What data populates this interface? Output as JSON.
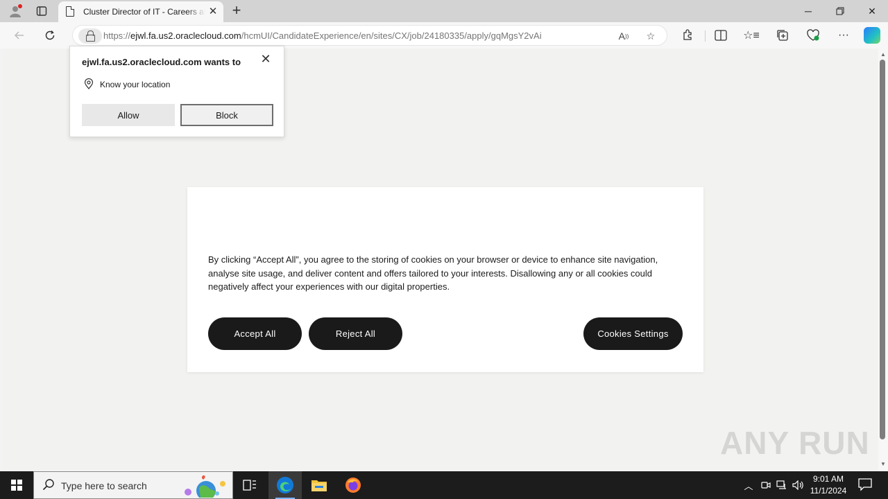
{
  "browser": {
    "tab_title": "Cluster Director of IT - Careers at",
    "url_prefix": "https://",
    "url_host": "ejwl.fa.us2.oraclecloud.com",
    "url_path": "/hcmUI/CandidateExperience/en/sites/CX/job/24180335/apply/gqMgsY2vAi"
  },
  "permission_popup": {
    "title": "ejwl.fa.us2.oraclecloud.com wants to",
    "request": "Know your location",
    "allow_label": "Allow",
    "block_label": "Block"
  },
  "cookie_dialog": {
    "text": "By clicking “Accept All”, you agree to the storing of cookies on your browser or device to enhance site navigation, analyse site usage, and deliver content and offers tailored to your interests. Disallowing any or all cookies could negatively affect your experiences with our digital properties.",
    "accept_label": "Accept All",
    "reject_label": "Reject All",
    "settings_label": "Cookies Settings"
  },
  "watermark": "ANY RUN",
  "taskbar": {
    "search_placeholder": "Type here to search",
    "time": "9:01 AM",
    "date": "11/1/2024"
  }
}
